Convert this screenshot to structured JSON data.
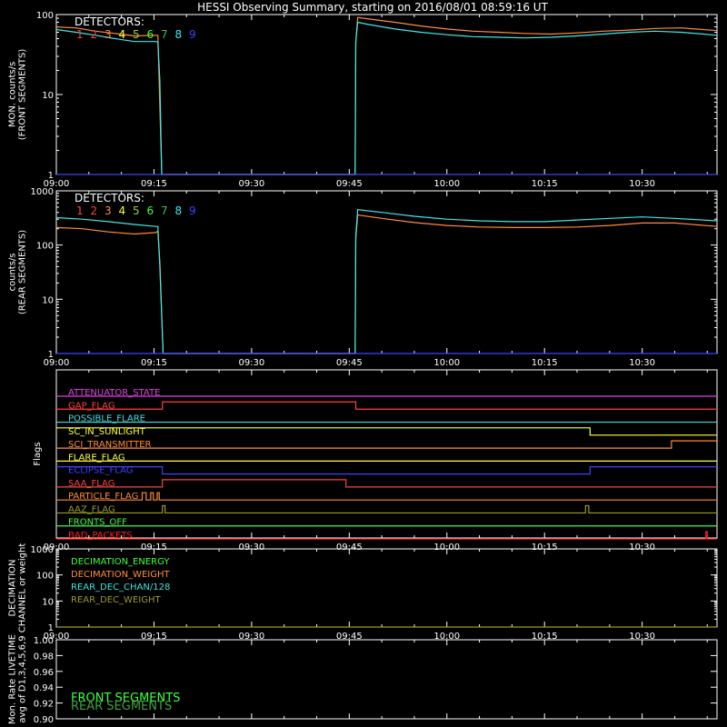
{
  "title": "HESSI Observing Summary, starting on 2016/08/01 08:59:16 UT",
  "colors": {
    "background": "#000000",
    "axes": "#ffffff",
    "det_orange": "#ff8c3a",
    "det_cyan": "#40e8e8"
  },
  "time_ticks": [
    "09:00",
    "09:15",
    "09:30",
    "09:45",
    "10:00",
    "10:15",
    "10:30"
  ],
  "chart_data": [
    {
      "type": "line",
      "id": "front",
      "ylabel": "MON. counts/s (FRONT SEGMENTS)",
      "ylabel_lines": [
        "MON. counts/s",
        "(FRONT SEGMENTS)"
      ],
      "y_scale": "log",
      "ylim": [
        1,
        100
      ],
      "y_ticks": [
        "1",
        "10",
        "100"
      ],
      "xlim_minutes": [
        0,
        101.5
      ],
      "legend_title": "DETECTORS:",
      "detector_labels": [
        {
          "label": "1",
          "color": "#ff4040"
        },
        {
          "label": "2",
          "color": "#ff4040"
        },
        {
          "label": "3",
          "color": "#ff8c3a"
        },
        {
          "label": "4",
          "color": "#ffff40"
        },
        {
          "label": "5",
          "color": "#9acd32"
        },
        {
          "label": "6",
          "color": "#40ff40"
        },
        {
          "label": "7",
          "color": "#40c040"
        },
        {
          "label": "8",
          "color": "#40e8e8"
        },
        {
          "label": "9",
          "color": "#4040ff"
        }
      ],
      "series": [
        {
          "color": "#ff8c3a",
          "points": [
            [
              0,
              70
            ],
            [
              3,
              68
            ],
            [
              6,
              62
            ],
            [
              9,
              58
            ],
            [
              12,
              54
            ],
            [
              15.3,
              55
            ],
            [
              15.6,
              55
            ],
            [
              16.2,
              1
            ],
            [
              45.9,
              1
            ],
            [
              46,
              45
            ],
            [
              46.3,
              92
            ],
            [
              48,
              88
            ],
            [
              52,
              80
            ],
            [
              56,
              72
            ],
            [
              60,
              66
            ],
            [
              64,
              62
            ],
            [
              68,
              60
            ],
            [
              72,
              58
            ],
            [
              76,
              57
            ],
            [
              80,
              59
            ],
            [
              84,
              62
            ],
            [
              88,
              64
            ],
            [
              92,
              67
            ],
            [
              96,
              68
            ],
            [
              101.5,
              63
            ]
          ]
        },
        {
          "color": "#40e8e8",
          "points": [
            [
              0,
              65
            ],
            [
              3,
              60
            ],
            [
              6,
              55
            ],
            [
              9,
              50
            ],
            [
              12,
              46
            ],
            [
              15.3,
              46
            ],
            [
              15.6,
              45
            ],
            [
              15.9,
              15
            ],
            [
              16.2,
              1
            ],
            [
              45.9,
              1
            ],
            [
              46,
              45
            ],
            [
              46.3,
              80
            ],
            [
              48,
              75
            ],
            [
              52,
              66
            ],
            [
              56,
              60
            ],
            [
              60,
              56
            ],
            [
              64,
              53
            ],
            [
              68,
              52
            ],
            [
              72,
              51
            ],
            [
              76,
              52
            ],
            [
              80,
              54
            ],
            [
              84,
              57
            ],
            [
              88,
              60
            ],
            [
              92,
              62
            ],
            [
              96,
              60
            ],
            [
              101.5,
              55
            ]
          ]
        },
        {
          "color": "#4040ff",
          "points": [
            [
              0,
              1
            ],
            [
              101.5,
              1
            ]
          ]
        }
      ]
    },
    {
      "type": "line",
      "id": "rear",
      "ylabel": "counts/s (REAR SEGMENTS)",
      "ylabel_lines": [
        "counts/s",
        "(REAR SEGMENTS)"
      ],
      "y_scale": "log",
      "ylim": [
        1,
        1000
      ],
      "y_ticks": [
        "1",
        "10",
        "100",
        "1000"
      ],
      "xlim_minutes": [
        0,
        101.5
      ],
      "legend_title": "DETECTORS:",
      "detector_labels": [
        {
          "label": "1",
          "color": "#ff4040"
        },
        {
          "label": "2",
          "color": "#ff4040"
        },
        {
          "label": "3",
          "color": "#ff8c3a"
        },
        {
          "label": "4",
          "color": "#ffff40"
        },
        {
          "label": "5",
          "color": "#9acd32"
        },
        {
          "label": "6",
          "color": "#40ff40"
        },
        {
          "label": "7",
          "color": "#40c040"
        },
        {
          "label": "8",
          "color": "#40e8e8"
        },
        {
          "label": "9",
          "color": "#4040ff"
        }
      ],
      "series": [
        {
          "color": "#ff8c3a",
          "points": [
            [
              0,
              210
            ],
            [
              4,
              200
            ],
            [
              8,
              175
            ],
            [
              12,
              160
            ],
            [
              15.3,
              170
            ],
            [
              15.6,
              180
            ],
            [
              15.9,
              50
            ],
            [
              16.4,
              1
            ],
            [
              45.9,
              1
            ],
            [
              46,
              130
            ],
            [
              46.3,
              360
            ],
            [
              50,
              310
            ],
            [
              55,
              260
            ],
            [
              60,
              230
            ],
            [
              65,
              215
            ],
            [
              70,
              210
            ],
            [
              75,
              210
            ],
            [
              80,
              215
            ],
            [
              85,
              230
            ],
            [
              90,
              255
            ],
            [
              95,
              255
            ],
            [
              101.5,
              220
            ]
          ]
        },
        {
          "color": "#40e8e8",
          "points": [
            [
              0,
              320
            ],
            [
              4,
              300
            ],
            [
              8,
              270
            ],
            [
              12,
              240
            ],
            [
              15.3,
              220
            ],
            [
              15.6,
              220
            ],
            [
              15.9,
              40
            ],
            [
              16.4,
              1
            ],
            [
              45.9,
              1
            ],
            [
              46,
              150
            ],
            [
              46.3,
              450
            ],
            [
              50,
              400
            ],
            [
              55,
              340
            ],
            [
              60,
              300
            ],
            [
              65,
              280
            ],
            [
              70,
              270
            ],
            [
              75,
              270
            ],
            [
              80,
              290
            ],
            [
              85,
              310
            ],
            [
              90,
              330
            ],
            [
              95,
              310
            ],
            [
              101.5,
              280
            ]
          ]
        },
        {
          "color": "#4040ff",
          "points": [
            [
              0,
              1
            ],
            [
              101.5,
              1
            ]
          ]
        }
      ]
    },
    {
      "type": "line",
      "id": "flags",
      "ylabel": "Flags",
      "xlim_minutes": [
        0,
        101.5
      ],
      "flags": [
        {
          "label": "ATTENUATOR_STATE",
          "color": "#e040e0",
          "segments": [
            [
              0,
              101.5,
              0
            ]
          ]
        },
        {
          "label": "GAP_FLAG",
          "color": "#ff4040",
          "segments": [
            [
              0,
              16.3,
              0
            ],
            [
              16.3,
              46,
              1
            ],
            [
              46,
              101.5,
              0
            ]
          ]
        },
        {
          "label": "POSSIBLE_FLARE",
          "color": "#40e0e0",
          "segments": [
            [
              0,
              101.5,
              0
            ]
          ]
        },
        {
          "label": "SC_IN_SUNLIGHT",
          "color": "#ffff40",
          "segments": [
            [
              0,
              82,
              1
            ],
            [
              82,
              101.5,
              0
            ]
          ]
        },
        {
          "label": "SCI_TRANSMITTER",
          "color": "#ff8c3a",
          "segments": [
            [
              0,
              94.5,
              0
            ],
            [
              94.5,
              101.5,
              1
            ]
          ]
        },
        {
          "label": "FLARE_FLAG",
          "color": "#ffff40",
          "segments": [
            [
              0,
              101.5,
              0
            ]
          ]
        },
        {
          "label": "ECLIPSE_FLAG",
          "color": "#4040ff",
          "segments": [
            [
              0,
              16.3,
              1
            ],
            [
              16.3,
              82,
              0
            ],
            [
              82,
              101.5,
              1
            ]
          ]
        },
        {
          "label": "SAA_FLAG",
          "color": "#ff4040",
          "segments": [
            [
              0,
              16.3,
              0
            ],
            [
              16.3,
              44.5,
              1
            ],
            [
              44.5,
              101.5,
              0
            ]
          ]
        },
        {
          "label": "PARTICLE_FLAG",
          "color": "#ff8c3a",
          "segments": [
            [
              0,
              13.2,
              0
            ],
            [
              13.2,
              13.8,
              1
            ],
            [
              13.8,
              14.5,
              0
            ],
            [
              14.5,
              14.9,
              1
            ],
            [
              14.9,
              15.5,
              0
            ],
            [
              15.5,
              15.8,
              1
            ],
            [
              15.8,
              101.5,
              0
            ]
          ]
        },
        {
          "label": "AAZ_FLAG",
          "color": "#9a9a2a",
          "segments": [
            [
              0,
              16.3,
              0
            ],
            [
              16.3,
              16.7,
              1
            ],
            [
              16.7,
              81.3,
              0
            ],
            [
              81.3,
              81.8,
              1
            ],
            [
              81.8,
              101.5,
              0
            ]
          ]
        },
        {
          "label": "FRONTS_OFF",
          "color": "#40ff40",
          "segments": [
            [
              0,
              101.5,
              0
            ]
          ]
        },
        {
          "label": "BAD_PACKETS",
          "color": "#ff2020",
          "segments": [
            [
              0,
              99.8,
              0
            ],
            [
              99.8,
              100.0,
              1
            ],
            [
              100.0,
              101.5,
              0
            ]
          ]
        }
      ]
    },
    {
      "type": "line",
      "id": "decimation",
      "ylabel": "DECIMATION CHANNEL or weight",
      "ylabel_lines": [
        "DECIMATION",
        "CHANNEL or weight"
      ],
      "y_scale": "log",
      "ylim": [
        1,
        1000
      ],
      "y_ticks": [
        "1",
        "10",
        "100",
        "1000"
      ],
      "xlim_minutes": [
        0,
        101.5
      ],
      "legend": [
        {
          "label": "DECIMATION_ENERGY",
          "color": "#40ff40"
        },
        {
          "label": "DECIMATION_WEIGHT",
          "color": "#ff8c3a"
        },
        {
          "label": "REAR_DEC_CHAN/128",
          "color": "#40e0e0"
        },
        {
          "label": "REAR_DEC_WEIGHT",
          "color": "#9a9a2a"
        }
      ],
      "series": [
        {
          "color": "#9a9a2a",
          "points": [
            [
              0,
              1
            ],
            [
              101.5,
              1
            ]
          ]
        }
      ]
    },
    {
      "type": "line",
      "id": "livetime",
      "ylabel": "Mon. Rate LIVETIME avg of D1,3,4,5,6,9",
      "ylabel_lines": [
        "Mon. Rate LIVETIME",
        "avg of D1,3,4,5,6,9"
      ],
      "ylim": [
        0.9,
        1.0
      ],
      "y_ticks": [
        "0.90",
        "0.92",
        "0.94",
        "0.96",
        "0.98",
        "1.00"
      ],
      "xlim_minutes": [
        0,
        101.5
      ],
      "legend": [
        {
          "label": "FRONT SEGMENTS",
          "color": "#40ff40"
        },
        {
          "label": "REAR SEGMENTS",
          "color": "#40a040"
        }
      ],
      "series": []
    }
  ]
}
